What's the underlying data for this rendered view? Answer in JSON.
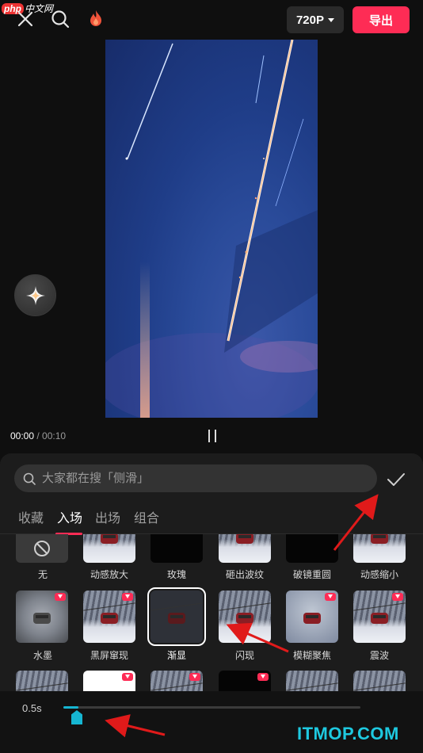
{
  "topbar": {
    "watermark_php": "php",
    "watermark_cn": "中文网",
    "resolution": "720P",
    "export_label": "导出"
  },
  "player": {
    "current_time": "00:00",
    "total_time": "/ 00:10"
  },
  "panel": {
    "search_placeholder": "大家都在搜「侧滑」",
    "tabs": [
      "收藏",
      "入场",
      "出场",
      "组合"
    ],
    "active_tab": 1,
    "effects_row1": [
      "无",
      "动感放大",
      "玫瑰",
      "砸出波纹",
      "破镜重圆",
      "动感缩小"
    ],
    "effects_row2": [
      "水墨",
      "黑屏窜现",
      "渐显",
      "闪现",
      "模糊聚焦",
      "震波"
    ],
    "selected_effect": "渐显"
  },
  "duration": {
    "label": "0.5s",
    "fraction": 0.05
  },
  "watermark_bottom": "ITMOP.COM",
  "colors": {
    "accent": "#fe2c55",
    "slider": "#16b6d2",
    "annotation_arrow": "#e01a1a"
  }
}
